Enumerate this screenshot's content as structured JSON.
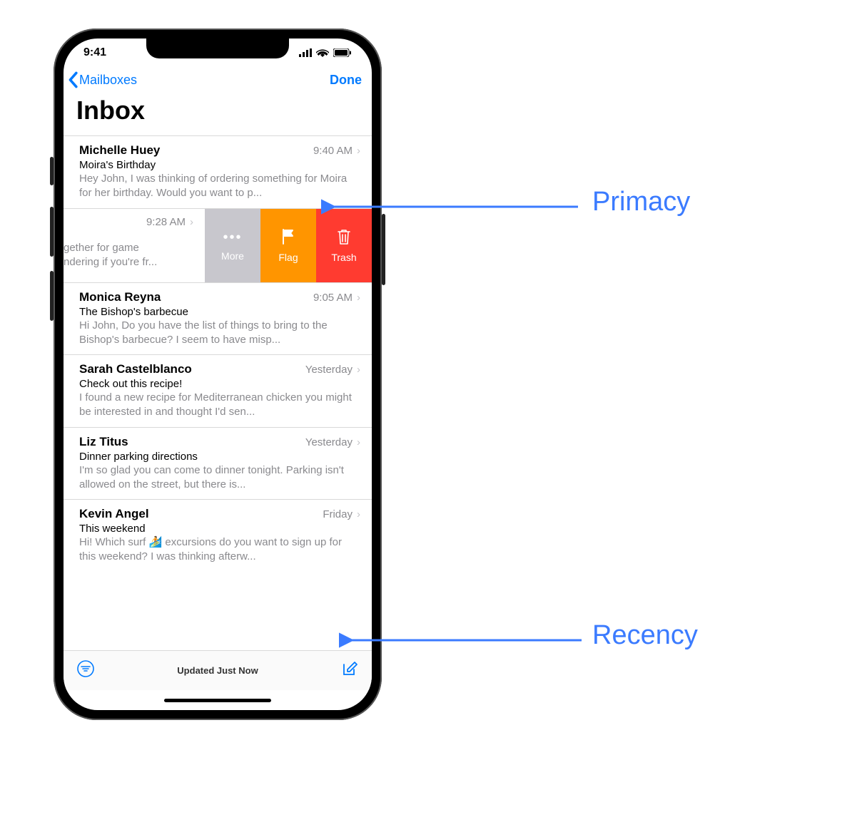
{
  "status": {
    "time": "9:41"
  },
  "nav": {
    "back_label": "Mailboxes",
    "done_label": "Done"
  },
  "title": "Inbox",
  "swipe_actions": {
    "more": "More",
    "flag": "Flag",
    "trash": "Trash"
  },
  "messages": [
    {
      "sender": "Michelle Huey",
      "time": "9:40 AM",
      "subject": "Moira's Birthday",
      "preview": "Hey John, I was thinking of ordering something for Moira for her birthday. Would you want to p..."
    },
    {
      "sender": "",
      "time": "9:28 AM",
      "subject": "",
      "preview": "gether for game\nndering if you're fr...",
      "swiped": true
    },
    {
      "sender": "Monica Reyna",
      "time": "9:05 AM",
      "subject": "The Bishop's barbecue",
      "preview": "Hi John, Do you have the list of things to bring to the Bishop's barbecue? I seem to have misp..."
    },
    {
      "sender": "Sarah Castelblanco",
      "time": "Yesterday",
      "subject": "Check out this recipe!",
      "preview": "I found a new recipe for Mediterranean chicken you might be interested in and thought I'd sen..."
    },
    {
      "sender": "Liz Titus",
      "time": "Yesterday",
      "subject": "Dinner parking directions",
      "preview": "I'm so glad you can come to dinner tonight. Parking isn't allowed on the street, but there is..."
    },
    {
      "sender": "Kevin Angel",
      "time": "Friday",
      "subject": "This weekend",
      "preview": "Hi! Which surf 🏄 excursions do you want to sign up for this weekend? I was thinking afterw..."
    }
  ],
  "toolbar": {
    "status": "Updated Just Now"
  },
  "annotations": {
    "primacy": "Primacy",
    "recency": "Recency"
  }
}
